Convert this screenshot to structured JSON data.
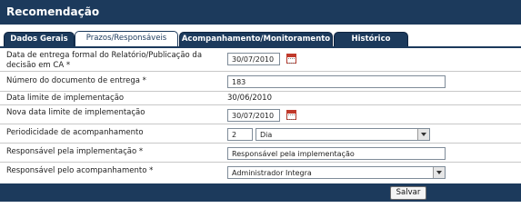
{
  "window": {
    "title": "Recomendação"
  },
  "tabs": [
    {
      "label": "Dados Gerais",
      "active": false
    },
    {
      "label": "Prazos/Responsáveis",
      "active": true
    },
    {
      "label": "Acompanhamento/Monitoramento",
      "active": false
    },
    {
      "label": "Histórico",
      "active": false
    }
  ],
  "form": {
    "data_entrega_label": "Data de entrega  formal do Relatório/Publicação da decisão em CA *",
    "data_entrega_value": "30/07/2010",
    "numero_documento_label": "Número do documento de entrega *",
    "numero_documento_value": "183",
    "data_limite_label": "Data limite de implementação",
    "data_limite_value": "30/06/2010",
    "nova_data_label": "Nova data limite de implementação",
    "nova_data_value": "30/07/2010",
    "periodicidade_label": "Periodicidade de acompanhamento",
    "periodicidade_numero": "2",
    "periodicidade_unidade": "Dia",
    "resp_impl_label": "Responsável pela implementação *",
    "resp_impl_value": "Responsável pela implementação",
    "resp_acomp_label": "Responsável pelo acompanhamento *",
    "resp_acomp_value": "Administrador Integra"
  },
  "footer": {
    "save_label": "Salvar"
  },
  "icons": {
    "calendar": "calendar-icon",
    "dropdown": "chevron-down-icon"
  },
  "colors": {
    "header": "#1c3a5c",
    "calendar": "#c0392b"
  }
}
